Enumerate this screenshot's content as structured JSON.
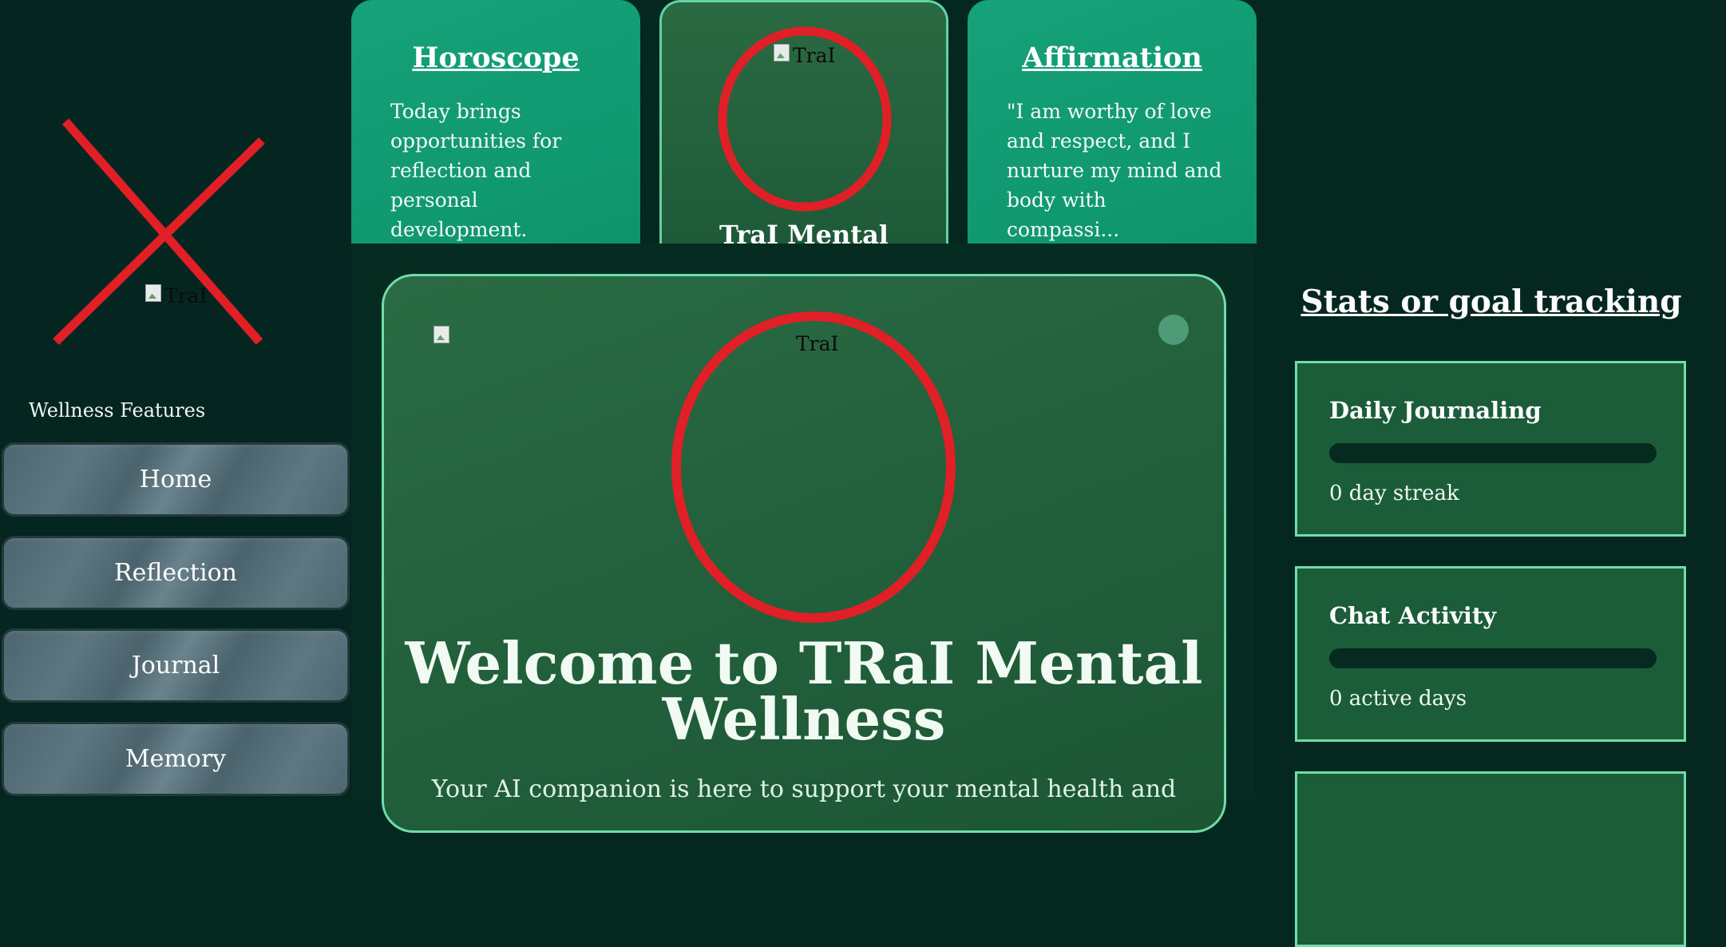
{
  "sidebar": {
    "logo_alt": "TraI",
    "section_label": "Wellness Features",
    "nav": [
      {
        "label": "Home"
      },
      {
        "label": "Reflection"
      },
      {
        "label": "Journal"
      },
      {
        "label": "Memory"
      }
    ]
  },
  "top_cards": {
    "horoscope": {
      "title": "Horoscope",
      "text": "Today brings opportunities for reflection and personal development."
    },
    "center": {
      "image_alt": "TraI",
      "title": "TraI Mental"
    },
    "affirmation": {
      "title": "Affirmation",
      "text": "\"I am worthy of love and respect, and I nurture my mind and body with compassi..."
    }
  },
  "welcome": {
    "image_alt_left": "",
    "image_alt_center": "TraI",
    "title": "Welcome to TRaI Mental Wellness",
    "subtitle": "Your AI companion is here to support your mental health and"
  },
  "stats": {
    "title": "Stats or goal tracking",
    "cards": [
      {
        "title": "Daily Journaling",
        "progress": 0,
        "value": "0 day streak"
      },
      {
        "title": "Chat Activity",
        "progress": 0,
        "value": "0 active days"
      }
    ]
  },
  "colors": {
    "background": "#042820",
    "accent": "#6fdcaa",
    "card_green": "#0e946b",
    "missing_image_mark": "#e01f26"
  },
  "icons": {
    "missing_image": "broken-image-icon",
    "status_dot": "status-dot-icon"
  }
}
